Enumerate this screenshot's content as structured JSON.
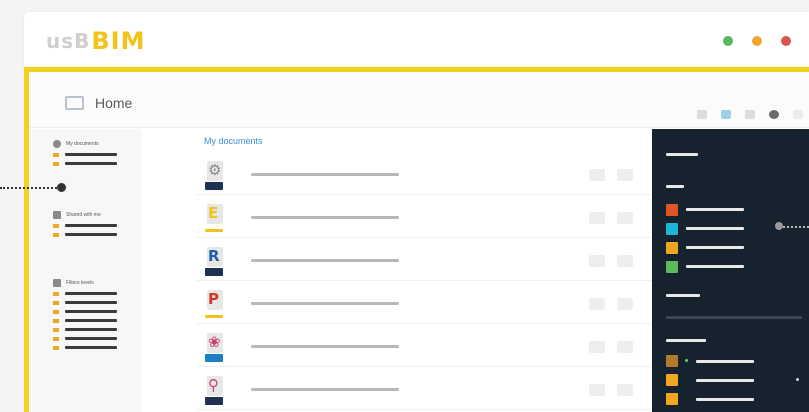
{
  "app": {
    "logo_prefix": "usB",
    "logo_main": "BIM",
    "window_controls": [
      {
        "name": "green-dot",
        "color": "#5cb85c"
      },
      {
        "name": "orange-dot",
        "color": "#f0a830"
      },
      {
        "name": "red-dot",
        "color": "#d9534f"
      }
    ]
  },
  "window": {
    "title": "Home",
    "toolbar_icons": [
      "grid-icon",
      "filter-icon",
      "list-icon",
      "info-icon",
      "more-icon"
    ]
  },
  "sidebar": {
    "sections": [
      {
        "label": "My documents",
        "icon": "user-icon",
        "rows": 2
      },
      {
        "label": "Shared with me",
        "icon": "share-icon",
        "rows": 2
      },
      {
        "label": "Filters levels",
        "icon": "folder-icon",
        "rows": 7
      }
    ]
  },
  "documents": {
    "heading": "My documents",
    "files": [
      {
        "type": "ifc",
        "glyph": "⚙",
        "glyph_color": "#8a8a8a",
        "tag_color": "#1f3152"
      },
      {
        "type": "excel",
        "glyph": "E",
        "glyph_color": "#f2c318",
        "tag_color": "#f2c318"
      },
      {
        "type": "revit",
        "glyph": "R",
        "glyph_color": "#1f5fa8",
        "tag_color": "#1f3152"
      },
      {
        "type": "pdf",
        "glyph": "P",
        "glyph_color": "#d23b2b",
        "tag_color": "#f2c318"
      },
      {
        "type": "model",
        "glyph": "❀",
        "glyph_color": "#c9416e",
        "tag_color": "#1b7fc1"
      },
      {
        "type": "location",
        "glyph": "⚲",
        "glyph_color": "#c9416e",
        "tag_color": "#1f3152"
      }
    ]
  },
  "panel": {
    "legend_colors": [
      "#e0542a",
      "#18b6d4",
      "#f0a61f",
      "#5cb85c"
    ],
    "level_colors": [
      "#b07a2a",
      "#f0a61f",
      "#f0a61f"
    ]
  }
}
